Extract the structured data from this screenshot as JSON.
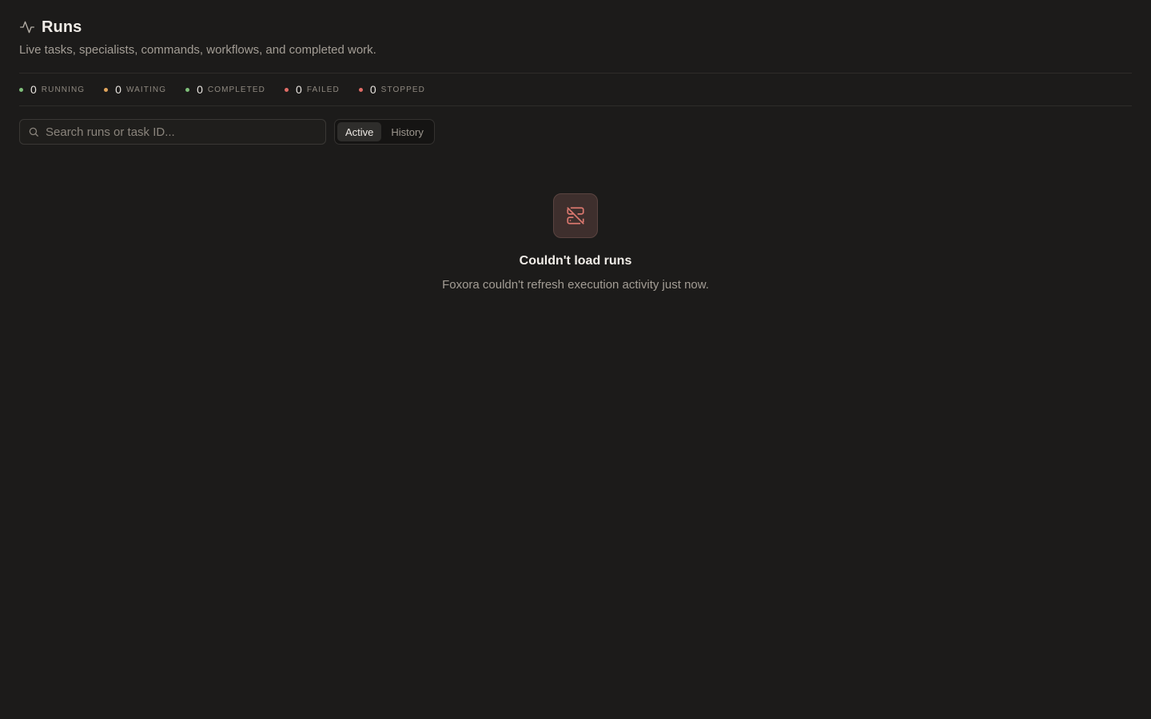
{
  "header": {
    "title": "Runs",
    "subtitle": "Live tasks, specialists, commands, workflows, and completed work.",
    "icon": "activity-icon"
  },
  "stats": [
    {
      "count": "0",
      "label": "Running",
      "color": "#7fbf7a"
    },
    {
      "count": "0",
      "label": "Waiting",
      "color": "#e0a45c"
    },
    {
      "count": "0",
      "label": "Completed",
      "color": "#7fbf7a"
    },
    {
      "count": "0",
      "label": "Failed",
      "color": "#e06c66"
    },
    {
      "count": "0",
      "label": "Stopped",
      "color": "#e06c66"
    }
  ],
  "search": {
    "placeholder": "Search runs or task ID...",
    "value": ""
  },
  "tabs": {
    "active": "Active",
    "history": "History",
    "selected": "Active"
  },
  "empty_state": {
    "icon": "server-off-icon",
    "title": "Couldn't load runs",
    "description": "Foxora couldn't refresh execution activity just now."
  },
  "colors": {
    "background": "#1c1b1a",
    "accent_error": "#d9776e"
  }
}
